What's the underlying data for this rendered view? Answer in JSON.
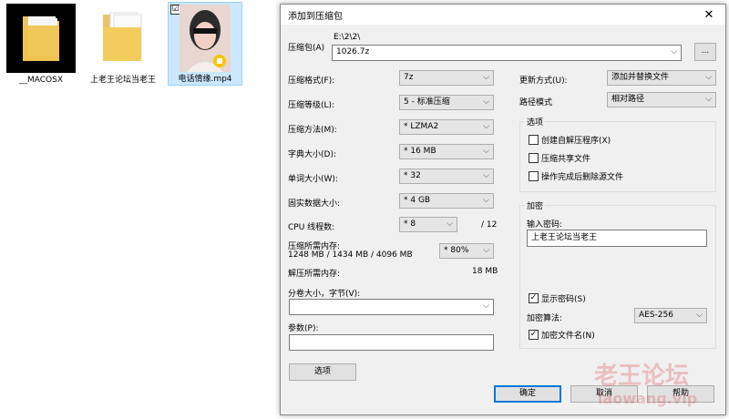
{
  "desktop": {
    "icons": [
      {
        "label": "__MACOSX"
      },
      {
        "label": "上老王论坛当老王"
      },
      {
        "label": "电话情缘.mp4",
        "checked_mark": "☑"
      }
    ]
  },
  "dialog": {
    "title": "添加到压缩包",
    "close_glyph": "✕",
    "archive": {
      "label": "压缩包(A)",
      "path": "E:\\2\\2\\",
      "filename": "1026.7z",
      "browse_label": "..."
    },
    "left": {
      "format": {
        "label": "压缩格式(F):",
        "value": "7z"
      },
      "level": {
        "label": "压缩等级(L):",
        "value": "5 - 标准压缩"
      },
      "method": {
        "label": "压缩方法(M):",
        "value": "* LZMA2"
      },
      "dict": {
        "label": "字典大小(D):",
        "value": "* 16 MB"
      },
      "word": {
        "label": "单词大小(W):",
        "value": "* 32"
      },
      "solid": {
        "label": "固实数据大小:",
        "value": "* 4 GB"
      },
      "cpu": {
        "label": "CPU 线程数:",
        "value": "* 8",
        "max": "/ 12"
      },
      "mem_comp": {
        "label": "压缩所需内存:",
        "detail": "1248 MB / 1434 MB / 4096 MB",
        "value": "* 80%"
      },
      "mem_decomp": {
        "label": "解压所需内存:",
        "value": "18 MB"
      },
      "split": {
        "label": "分卷大小，字节(V):",
        "value": ""
      },
      "params": {
        "label": "参数(P):",
        "value": ""
      },
      "options_button": "选项"
    },
    "right": {
      "update": {
        "label": "更新方式(U):",
        "value": "添加并替换文件"
      },
      "pathmode": {
        "label": "路径模式",
        "value": "相对路径"
      },
      "options_group": "选项",
      "opt_sfx": "创建自解压程序(X)",
      "opt_shared": "压缩共享文件",
      "opt_delete": "操作完成后删除源文件",
      "encrypt_group": "加密",
      "password_label": "输入密码:",
      "password_value": "上老王论坛当老王",
      "show_password": "显示密码(S)",
      "show_password_checked": "✓",
      "enc_method_label": "加密算法:",
      "enc_method_value": "AES-256",
      "encrypt_names": "加密文件名(N)",
      "encrypt_names_checked": "✓"
    },
    "buttons": {
      "ok": "确定",
      "cancel": "取消",
      "help": "帮助"
    },
    "dropdown_arrow": "⌵"
  },
  "watermark": {
    "line1": "老王论坛",
    "line2": "laowang.vip"
  }
}
